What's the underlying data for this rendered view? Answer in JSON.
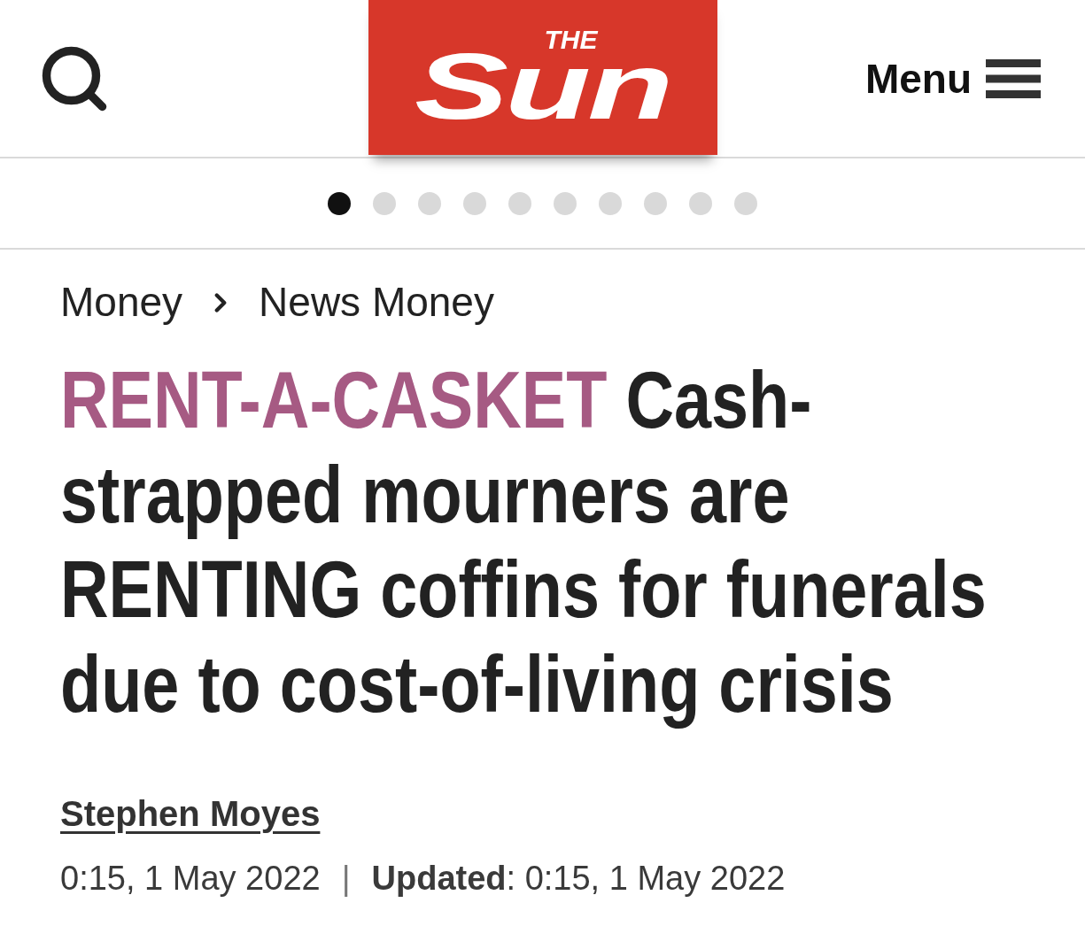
{
  "header": {
    "logo": {
      "small": "THE",
      "large": "Sun"
    },
    "menu_label": "Menu"
  },
  "carousel_dots": [
    {
      "selected": true
    },
    {
      "selected": false
    },
    {
      "selected": false
    },
    {
      "selected": false
    },
    {
      "selected": false
    },
    {
      "selected": false
    },
    {
      "selected": false
    },
    {
      "selected": false
    },
    {
      "selected": false
    },
    {
      "selected": false
    }
  ],
  "breadcrumb": [
    "Money",
    "News Money"
  ],
  "headline": {
    "kicker": "RENT-A-CASKET",
    "text": "Cash-strapped mourners are RENTING coffins for funerals due to cost-of-living crisis"
  },
  "byline": {
    "author": "Stephen Moyes"
  },
  "timestamps": {
    "published": "0:15, 1 May 2022",
    "separator": "|",
    "updated": "**Updated**: 0:15, 1 May 2022"
  }
}
